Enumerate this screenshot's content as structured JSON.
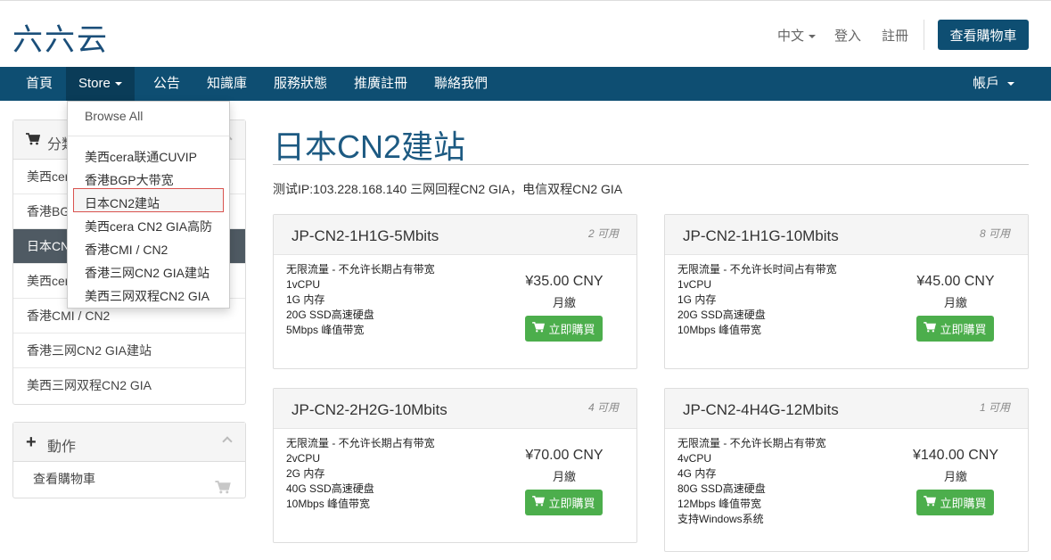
{
  "header": {
    "logo": "六六云",
    "language": "中文",
    "login": "登入",
    "register": "註冊",
    "view_cart": "查看購物車"
  },
  "nav": {
    "items": [
      "首頁",
      "Store",
      "公告",
      "知識庫",
      "服務狀態",
      "推廣註冊",
      "聯絡我們"
    ],
    "account": "帳戶"
  },
  "store_dropdown": {
    "browse_all": "Browse All",
    "items": [
      "美西cera联通CUVIP",
      "香港BGP大带宽",
      "日本CN2建站",
      "美西cera CN2 GIA高防",
      "香港CMI / CN2",
      "香港三网CN2 GIA建站",
      "美西三网双程CN2 GIA"
    ],
    "selected": "日本CN2建站"
  },
  "sidebar": {
    "categories_title": "分類",
    "categories": [
      "美西cera联通CUVIP",
      "香港BGP大带宽",
      "日本CN2建站",
      "美西cera CN2 GIA高防",
      "香港CMI / CN2",
      "香港三网CN2 GIA建站",
      "美西三网双程CN2 GIA"
    ],
    "actions_title": "動作",
    "actions": [
      "查看購物車"
    ]
  },
  "main": {
    "title": "日本CN2建站",
    "description": "测试IP:103.228.168.140 三网回程CN2 GIA，电信双程CN2 GIA",
    "products": [
      {
        "name": "JP-CN2-1H1G-5Mbits",
        "availability": "2 可用",
        "features": [
          "无限流量 - 不允许长期占有带宽",
          "1vCPU",
          "1G 内存",
          "20G SSD高速硬盘",
          "5Mbps 峰值带宽"
        ],
        "price": "¥35.00 CNY",
        "cycle": "月繳",
        "buy_label": "立即購買"
      },
      {
        "name": "JP-CN2-1H1G-10Mbits",
        "availability": "8 可用",
        "features": [
          "无限流量 - 不允许长时间占有带宽",
          "1vCPU",
          "1G 内存",
          "20G SSD高速硬盘",
          "10Mbps 峰值带宽"
        ],
        "price": "¥45.00 CNY",
        "cycle": "月繳",
        "buy_label": "立即購買"
      },
      {
        "name": "JP-CN2-2H2G-10Mbits",
        "availability": "4 可用",
        "features": [
          "无限流量 - 不允许长期占有带宽",
          "2vCPU",
          "2G 内存",
          "40G SSD高速硬盘",
          "10Mbps 峰值带宽"
        ],
        "price": "¥70.00 CNY",
        "cycle": "月繳",
        "buy_label": "立即購買"
      },
      {
        "name": "JP-CN2-4H4G-12Mbits",
        "availability": "1 可用",
        "features": [
          "无限流量 - 不允许长期占有带宽",
          "4vCPU",
          "4G 内存",
          "80G SSD高速硬盘",
          "12Mbps 峰值带宽",
          "支持Windows系统"
        ],
        "price": "¥140.00 CNY",
        "cycle": "月繳",
        "buy_label": "立即購買"
      }
    ]
  },
  "colors": {
    "brand": "#0e4e72",
    "buy_button": "#4cae4c",
    "selected_category": "#4f5a63"
  }
}
